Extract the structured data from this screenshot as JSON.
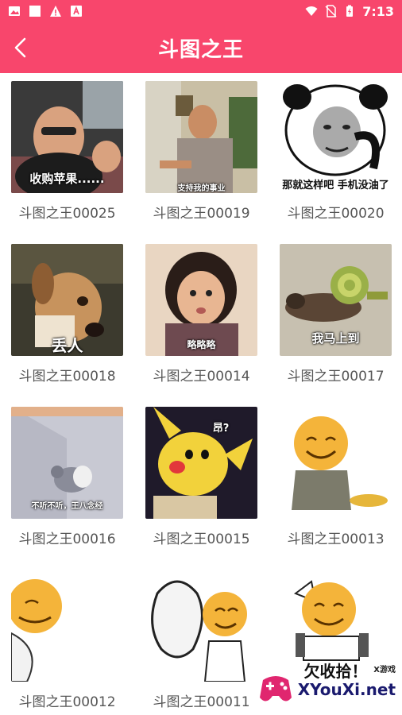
{
  "status_bar": {
    "time": "7:13",
    "icons": [
      "image-icon",
      "square-icon",
      "warning-icon",
      "text-icon",
      "wifi-icon",
      "no-sim-icon",
      "battery-charging-icon"
    ]
  },
  "app_bar": {
    "title": "斗图之王",
    "back_icon": "chevron-left-icon"
  },
  "colors": {
    "brand": "#f8466c",
    "caption": "#555555"
  },
  "items": [
    {
      "caption": "斗图之王00025",
      "overlay": "收购苹果......"
    },
    {
      "caption": "斗图之王00019",
      "overlay": "支持我的事业"
    },
    {
      "caption": "斗图之王00020",
      "overlay": "那就这样吧 手机没油了"
    },
    {
      "caption": "斗图之王00018",
      "overlay": "丢人"
    },
    {
      "caption": "斗图之王00014",
      "overlay": "略略略"
    },
    {
      "caption": "斗图之王00017",
      "overlay": "我马上到"
    },
    {
      "caption": "斗图之王00016",
      "overlay": "不听不听，王八念经"
    },
    {
      "caption": "斗图之王00015",
      "overlay": "昂?"
    },
    {
      "caption": "斗图之王00013",
      "overlay": ""
    },
    {
      "caption": "斗图之王00012",
      "overlay": ""
    },
    {
      "caption": "斗图之王00011",
      "overlay": ""
    },
    {
      "caption": "",
      "overlay": "欠收拾！"
    }
  ],
  "watermark": {
    "text": "XYouXi.net",
    "small": "X游戏"
  }
}
